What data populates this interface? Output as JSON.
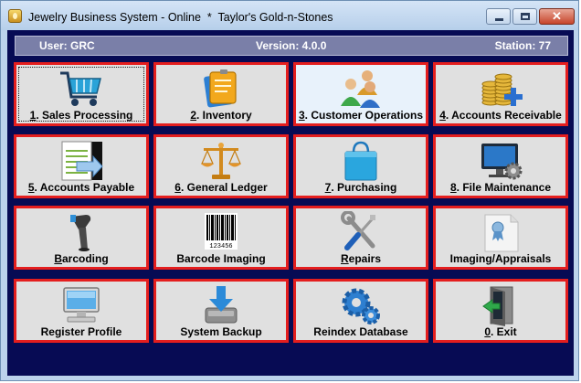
{
  "window": {
    "title": "Jewelry Business System - Online  *  Taylor's Gold-n-Stones",
    "minimize_glyph": "—",
    "maximize_glyph": "□",
    "close_glyph": "✕"
  },
  "status": {
    "user": "User: GRC",
    "version": "Version: 4.0.0",
    "station": "Station: 77"
  },
  "menu": [
    {
      "key": "1",
      "text": ". Sales Processing",
      "icon": "shopping-cart-icon"
    },
    {
      "key": "2",
      "text": ". Inventory",
      "icon": "inventory-box-icon"
    },
    {
      "key": "3",
      "text": ". Customer Operations",
      "icon": "customers-icon"
    },
    {
      "key": "4",
      "text": ". Accounts Receivable",
      "icon": "coins-plus-icon"
    },
    {
      "key": "5",
      "text": ". Accounts Payable",
      "icon": "invoice-icon"
    },
    {
      "key": "6",
      "text": ". General Ledger",
      "icon": "scales-icon"
    },
    {
      "key": "7",
      "text": ". Purchasing",
      "icon": "shopping-bag-icon"
    },
    {
      "key": "8",
      "text": ". File Maintenance",
      "icon": "monitor-gear-icon"
    },
    {
      "key": "B",
      "text": "arcoding",
      "icon": "barcode-scanner-icon"
    },
    {
      "key": "",
      "text": "Barcode Imaging",
      "icon": "barcode-icon"
    },
    {
      "key": "R",
      "text": "epairs",
      "icon": "tools-icon"
    },
    {
      "key": "",
      "text": "Imaging/Appraisals",
      "icon": "certificate-icon"
    },
    {
      "key": "",
      "text": "Register Profile",
      "icon": "register-monitor-icon"
    },
    {
      "key": "",
      "text": "System Backup",
      "icon": "backup-drive-icon"
    },
    {
      "key": "",
      "text": "Reindex Database",
      "icon": "database-gear-icon"
    },
    {
      "key": "0",
      "text": ". Exit",
      "icon": "exit-door-icon"
    }
  ],
  "barcode_number": "123456"
}
